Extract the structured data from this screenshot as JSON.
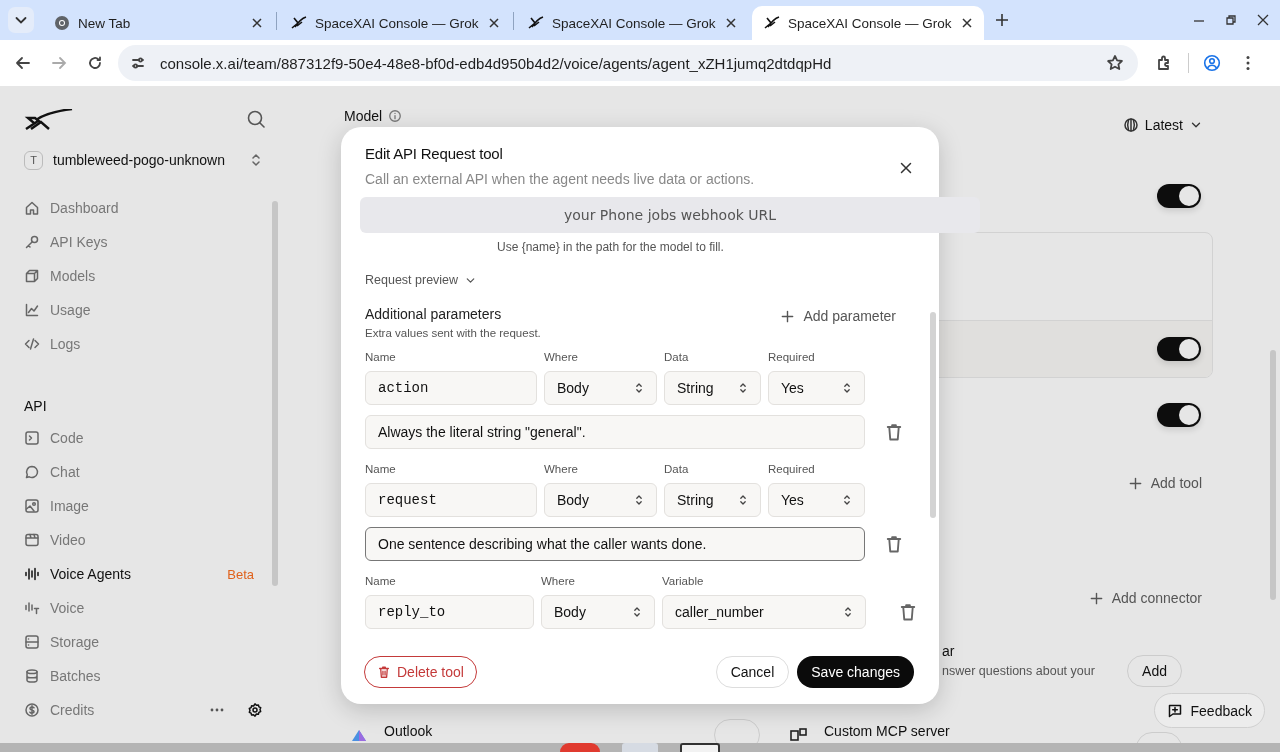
{
  "browser": {
    "tabs": [
      {
        "title": "New Tab",
        "selected": false,
        "kind": "newtab"
      },
      {
        "title": "SpaceXAI Console — Grok",
        "selected": false,
        "kind": "site"
      },
      {
        "title": "SpaceXAI Console — Grok",
        "selected": false,
        "kind": "site"
      },
      {
        "title": "SpaceXAI Console — Grok",
        "selected": true,
        "kind": "site"
      }
    ],
    "url": "console.x.ai/team/887312f9-50e4-48e8-bf0d-edb4d950b4d2/voice/agents/agent_xZH1jumq2dtdqpHd"
  },
  "sidebar": {
    "team": {
      "initial": "T",
      "name": "tumbleweed-pogo-unknown"
    },
    "nav": [
      {
        "label": "Dashboard",
        "selected": false
      },
      {
        "label": "API Keys",
        "selected": false
      },
      {
        "label": "Models",
        "selected": false
      },
      {
        "label": "Usage",
        "selected": false
      },
      {
        "label": "Logs",
        "selected": false
      }
    ],
    "section": "API",
    "api_nav": [
      {
        "label": "Code",
        "selected": false
      },
      {
        "label": "Chat",
        "selected": false
      },
      {
        "label": "Image",
        "selected": false
      },
      {
        "label": "Video",
        "selected": false
      },
      {
        "label": "Voice Agents",
        "selected": true,
        "badge": "Beta"
      },
      {
        "label": "Voice",
        "selected": false
      },
      {
        "label": "Storage",
        "selected": false
      },
      {
        "label": "Batches",
        "selected": false
      }
    ],
    "footer": {
      "label": "Credits"
    }
  },
  "main": {
    "model_label": "Model",
    "version": "Latest",
    "toggles": [
      {
        "on": true
      },
      {
        "on": true
      },
      {
        "on": true
      }
    ],
    "add_tool": "Add tool",
    "add_connector": "Add connector",
    "connectors": [
      {
        "title": "ar",
        "description": "nswer questions about your",
        "button": "Add"
      },
      {
        "title": "Outlook"
      },
      {
        "title": "Custom MCP server"
      }
    ]
  },
  "feedback": "Feedback",
  "dialog": {
    "title": "Edit API Request tool",
    "subtitle": "Call an external API when the agent needs live data or actions.",
    "url_suggestion": "your Phone jobs webhook URL",
    "path_hint": "Use {name} in the path for the model to fill.",
    "request_preview": "Request preview",
    "params_title": "Additional parameters",
    "params_subtitle": "Extra values sent with the request.",
    "add_parameter": "Add parameter",
    "parameters": [
      {
        "fields": [
          {
            "label": "Name",
            "value": "action",
            "kind": "text"
          },
          {
            "label": "Where",
            "value": "Body",
            "kind": "select"
          },
          {
            "label": "Data",
            "value": "String",
            "kind": "select"
          },
          {
            "label": "Required",
            "value": "Yes",
            "kind": "select"
          }
        ],
        "description": {
          "value": "Always the literal string \"general\".",
          "focused": false
        }
      },
      {
        "fields": [
          {
            "label": "Name",
            "value": "request",
            "kind": "text"
          },
          {
            "label": "Where",
            "value": "Body",
            "kind": "select"
          },
          {
            "label": "Data",
            "value": "String",
            "kind": "select"
          },
          {
            "label": "Required",
            "value": "Yes",
            "kind": "select"
          }
        ],
        "description": {
          "value": "One sentence describing what the caller wants done.",
          "focused": true
        }
      },
      {
        "fields": [
          {
            "label": "Name",
            "value": "reply_to",
            "kind": "text"
          },
          {
            "label": "Where",
            "value": "Body",
            "kind": "select"
          },
          {
            "label": "Variable",
            "value": "caller_number",
            "kind": "select"
          }
        ]
      }
    ],
    "delete": "Delete tool",
    "cancel": "Cancel",
    "save": "Save changes"
  }
}
